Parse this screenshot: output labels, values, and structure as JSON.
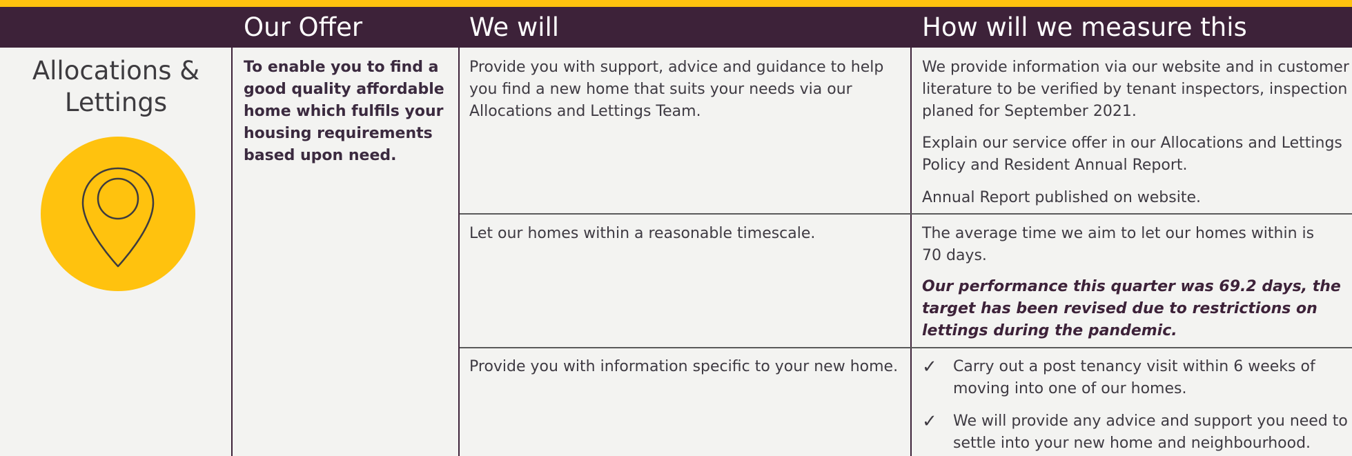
{
  "header": {
    "col_offer": "Our Offer",
    "col_will": "We will",
    "col_measure": "How will we measure this"
  },
  "section": {
    "title_line1": "Allocations &",
    "title_line2": "Lettings",
    "icon": "location-pin-icon",
    "offer_text": "To enable you to find a good quality affordable home which fulfils your housing requirements based upon need."
  },
  "rows": [
    {
      "will": "Provide you with support, advice and guidance to help you find a new home that suits your needs via our Allocations and Lettings Team.",
      "measure": [
        "We provide information via our website and in customer literature to be verified by tenant inspectors, inspection planed for September 2021.",
        "Explain our service offer in our Allocations and Lettings Policy and Resident Annual Report.",
        "Annual Report published on website."
      ]
    },
    {
      "will": "Let our homes within a reasonable timescale.",
      "measure_line1": "The average time we aim to let our homes within is",
      "measure_line2": "70 days.",
      "performance": "Our performance this quarter was 69.2 days, the target has been revised due to restrictions on lettings during the pandemic."
    },
    {
      "will": "Provide you with information specific to your new home.",
      "checks": [
        "Carry out a post tenancy visit within 6 weeks of moving into one of our homes.",
        "We will provide any advice and support you need to settle into your new home and neighbourhood."
      ],
      "check_glyph": "✓"
    }
  ],
  "colors": {
    "header_bg": "#3d2239",
    "accent_yellow": "#ffc20e",
    "page_bg": "#f3f3f1"
  }
}
